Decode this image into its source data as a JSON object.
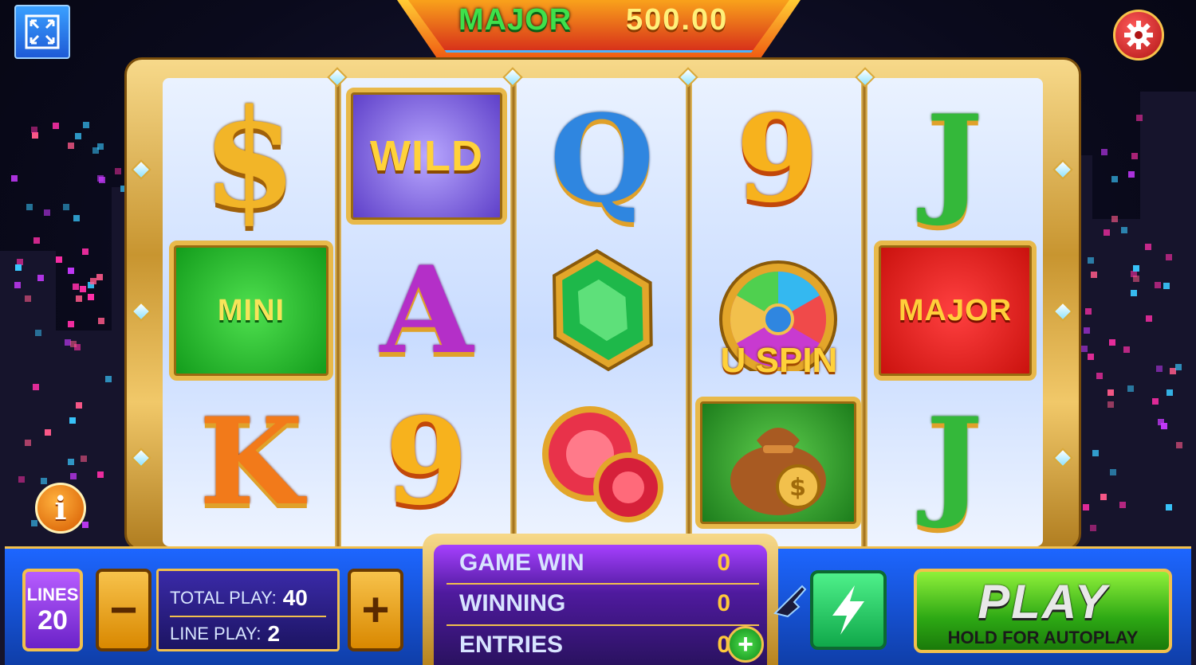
{
  "colors": {
    "banner": "#f05a12",
    "frame_gold": "#f2c04c",
    "bottom_bar": "#1d66ff",
    "play_green": "#2da814"
  },
  "jackpot": {
    "label": "MAJOR",
    "value": "500.00"
  },
  "icons": {
    "fullscreen": "fullscreen-icon",
    "settings": "gear-icon",
    "info": "info-icon",
    "turbo": "lightning-icon",
    "hand": "pointing-hand-icon"
  },
  "info_glyph": "i",
  "reels": [
    [
      "$",
      "WILD",
      "Q",
      "9",
      "J"
    ],
    [
      "MINI",
      "A",
      "emerald",
      "U SPIN",
      "MAJOR"
    ],
    [
      "K",
      "9",
      "rubies",
      "money-bag",
      "J"
    ]
  ],
  "symbols": {
    "dollar": "$",
    "wild": "WILD",
    "queen": "Q",
    "nine_top": "9",
    "jack_top": "J",
    "mini": "MINI",
    "ace": "A",
    "uspin": "U SPIN",
    "major": "MAJOR",
    "king": "K",
    "nine_bottom": "9",
    "jack_bottom": "J"
  },
  "controls": {
    "lines_label": "LINES",
    "lines_value": "20",
    "minus": "−",
    "plus": "+",
    "total_play_label": "TOTAL PLAY:",
    "total_play_value": "40",
    "line_play_label": "LINE PLAY:",
    "line_play_value": "2"
  },
  "win_panel": {
    "game_win_label": "GAME WIN",
    "game_win_value": "0",
    "winning_label": "WINNING",
    "winning_value": "0",
    "entries_label": "ENTRIES",
    "entries_value": "0",
    "add_entries": "+"
  },
  "play": {
    "label": "PLAY",
    "sub": "HOLD FOR AUTOPLAY"
  }
}
